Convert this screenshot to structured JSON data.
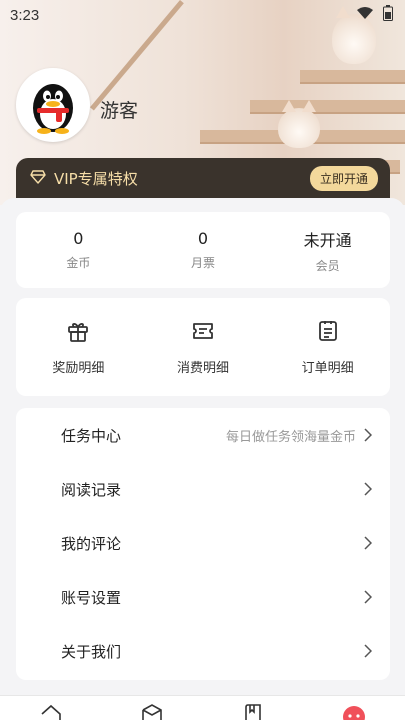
{
  "status_bar": {
    "time": "3:23",
    "icons": [
      "wifi-icon",
      "battery-icon"
    ]
  },
  "profile": {
    "username": "游客",
    "avatar": "qq-penguin-avatar"
  },
  "vip": {
    "label": "VIP专属特权",
    "button": "立即开通",
    "colors": {
      "bar": "#3a332c",
      "text": "#f6dea8",
      "button": "#f3d89b"
    }
  },
  "stats": [
    {
      "value": "0",
      "label": "金币"
    },
    {
      "value": "0",
      "label": "月票"
    },
    {
      "value": "未开通",
      "label": "会员"
    }
  ],
  "actions": [
    {
      "label": "奖励明细",
      "icon": "gift-icon"
    },
    {
      "label": "消费明细",
      "icon": "ticket-icon"
    },
    {
      "label": "订单明细",
      "icon": "order-list-icon"
    }
  ],
  "menu": [
    {
      "label": "任务中心",
      "hint": "每日做任务领海量金币"
    },
    {
      "label": "阅读记录",
      "hint": ""
    },
    {
      "label": "我的评论",
      "hint": ""
    },
    {
      "label": "账号设置",
      "hint": ""
    },
    {
      "label": "关于我们",
      "hint": ""
    }
  ],
  "tabbar": {
    "icons": [
      "home-icon",
      "cube-icon",
      "book-icon",
      "profile-icon"
    ],
    "active": "profile-icon",
    "active_color": "#f0505a"
  }
}
